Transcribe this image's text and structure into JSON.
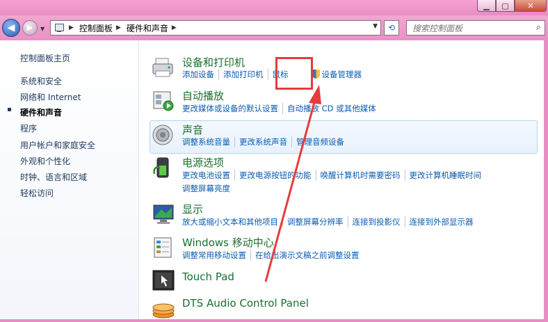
{
  "window": {
    "controls": [
      "minimize-icon",
      "maximize-icon",
      "close-icon"
    ]
  },
  "nav": {
    "breadcrumbs": [
      "控制面板",
      "硬件和声音"
    ],
    "search_placeholder": "搜索控制面板"
  },
  "sidebar": {
    "items": [
      {
        "label": "控制面板主页",
        "active": false
      },
      {
        "label": "系统和安全",
        "active": false
      },
      {
        "label": "网络和 Internet",
        "active": false
      },
      {
        "label": "硬件和声音",
        "active": true
      },
      {
        "label": "程序",
        "active": false
      },
      {
        "label": "用户帐户和家庭安全",
        "active": false
      },
      {
        "label": "外观和个性化",
        "active": false
      },
      {
        "label": "时钟、语言和区域",
        "active": false
      },
      {
        "label": "轻松访问",
        "active": false
      }
    ]
  },
  "categories": [
    {
      "title": "设备和打印机",
      "icon": "printer-icon",
      "links": [
        "添加设备",
        "添加打印机",
        "鼠标",
        "设备管理器"
      ]
    },
    {
      "title": "自动播放",
      "icon": "autoplay-icon",
      "links": [
        "更改媒体或设备的默认设置",
        "自动播放 CD 或其他媒体"
      ]
    },
    {
      "title": "声音",
      "icon": "speaker-icon",
      "links": [
        "调整系统音量",
        "更改系统声音",
        "管理音频设备"
      ]
    },
    {
      "title": "电源选项",
      "icon": "battery-icon",
      "links": [
        "更改电池设置",
        "更改电源按钮的功能",
        "唤醒计算机时需要密码",
        "更改计算机睡眠时间"
      ],
      "links2": [
        "调整屏幕亮度"
      ]
    },
    {
      "title": "显示",
      "icon": "monitor-icon",
      "links": [
        "放大或缩小文本和其他项目",
        "调整屏幕分辨率",
        "连接到投影仪",
        "连接到外部显示器"
      ]
    },
    {
      "title": "Windows 移动中心",
      "icon": "mobility-center-icon",
      "links": [
        "调整常用移动设置",
        "在给出演示文稿之前调整设置"
      ]
    },
    {
      "title": "Touch Pad",
      "icon": "touchpad-icon",
      "links": []
    },
    {
      "title": "DTS Audio Control Panel",
      "icon": "dts-icon",
      "links": []
    }
  ],
  "colors": {
    "title_green": "#1a6f2f",
    "link_blue": "#0a5cb0",
    "annotation_red": "#e53b3b",
    "chrome_pink": "#e98ec5"
  }
}
